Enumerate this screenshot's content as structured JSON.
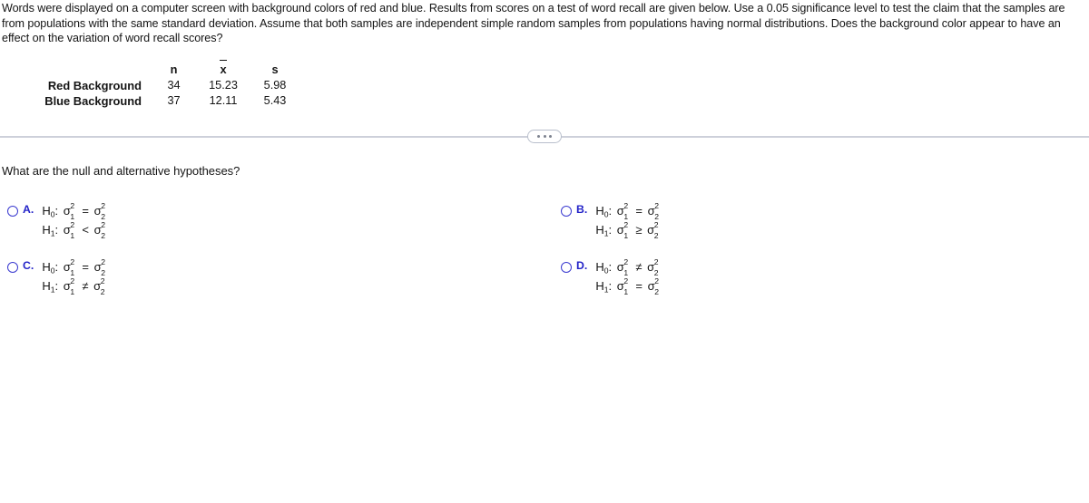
{
  "problem": {
    "statement": "Words were displayed on a computer screen with background colors of red and blue. Results from scores on a test of word recall are given below. Use a 0.05 significance level to test the claim that the samples are from populations with the same standard deviation. Assume that both samples are independent simple random samples from populations having normal distributions. Does the background color appear to have an effect on the variation of word recall scores?"
  },
  "stats_table": {
    "headers": [
      "",
      "n",
      "x̄",
      "s"
    ],
    "rows": [
      {
        "label": "Red Background",
        "n": "34",
        "xbar": "15.23",
        "s": "5.98"
      },
      {
        "label": "Blue Background",
        "n": "37",
        "xbar": "12.11",
        "s": "5.43"
      }
    ]
  },
  "divider": {
    "dots_label": "•••",
    "icon": "ellipsis-icon"
  },
  "question": {
    "prompt": "What are the null and alternative hypotheses?"
  },
  "options": [
    {
      "letter": "A.",
      "selected": false,
      "null_hypothesis": {
        "name": "H",
        "index": "0",
        "left_sym": "σ",
        "left_sup": "2",
        "left_sub": "1",
        "relation": "=",
        "right_sym": "σ",
        "right_sup": "2",
        "right_sub": "2"
      },
      "alt_hypothesis": {
        "name": "H",
        "index": "1",
        "left_sym": "σ",
        "left_sup": "2",
        "left_sub": "1",
        "relation": "<",
        "right_sym": "σ",
        "right_sup": "2",
        "right_sub": "2"
      }
    },
    {
      "letter": "B.",
      "selected": false,
      "null_hypothesis": {
        "name": "H",
        "index": "0",
        "left_sym": "σ",
        "left_sup": "2",
        "left_sub": "1",
        "relation": "=",
        "right_sym": "σ",
        "right_sup": "2",
        "right_sub": "2"
      },
      "alt_hypothesis": {
        "name": "H",
        "index": "1",
        "left_sym": "σ",
        "left_sup": "2",
        "left_sub": "1",
        "relation": "≥",
        "right_sym": "σ",
        "right_sup": "2",
        "right_sub": "2"
      }
    },
    {
      "letter": "C.",
      "selected": false,
      "null_hypothesis": {
        "name": "H",
        "index": "0",
        "left_sym": "σ",
        "left_sup": "2",
        "left_sub": "1",
        "relation": "=",
        "right_sym": "σ",
        "right_sup": "2",
        "right_sub": "2"
      },
      "alt_hypothesis": {
        "name": "H",
        "index": "1",
        "left_sym": "σ",
        "left_sup": "2",
        "left_sub": "1",
        "relation": "≠",
        "right_sym": "σ",
        "right_sup": "2",
        "right_sub": "2"
      }
    },
    {
      "letter": "D.",
      "selected": false,
      "null_hypothesis": {
        "name": "H",
        "index": "0",
        "left_sym": "σ",
        "left_sup": "2",
        "left_sub": "1",
        "relation": "≠",
        "right_sym": "σ",
        "right_sup": "2",
        "right_sub": "2"
      },
      "alt_hypothesis": {
        "name": "H",
        "index": "1",
        "left_sym": "σ",
        "left_sup": "2",
        "left_sub": "1",
        "relation": "=",
        "right_sym": "σ",
        "right_sup": "2",
        "right_sub": "2"
      }
    }
  ],
  "colors": {
    "option_blue": "#2323c8",
    "text": "#141414",
    "divider": "#cdd0da",
    "pill_border": "#b9bfcc"
  }
}
